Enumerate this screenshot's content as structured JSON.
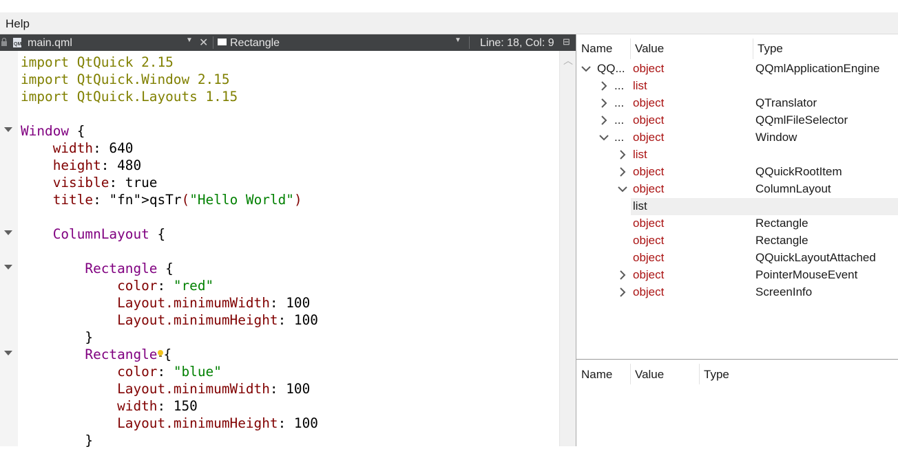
{
  "menubar": {
    "help": "Help"
  },
  "toolbar": {
    "file_name": "main.qml",
    "symbol": "Rectangle",
    "cursor_position": "Line: 18, Col: 9"
  },
  "editor": {
    "lines": {
      "l1": "import QtQuick 2.15",
      "l2": "import QtQuick.Window 2.15",
      "l3": "import QtQuick.Layouts 1.15",
      "l5": "Window {",
      "l6": "width: 640",
      "l7": "height: 480",
      "l8": "visible: true",
      "l9": "title: qsTr(\"Hello World\")",
      "l11": "ColumnLayout {",
      "l13": "Rectangle {",
      "l14": "color: \"red\"",
      "l15": "Layout.minimumWidth: 100",
      "l16": "Layout.minimumHeight: 100",
      "l17": "}",
      "l18": "Rectangle{",
      "l19": "color: \"blue\"",
      "l20": "Layout.minimumWidth: 100",
      "l21": "width: 150",
      "l22": "Layout.minimumHeight: 100",
      "l23": "}"
    }
  },
  "object_tree": {
    "columns": {
      "name": "Name",
      "value": "Value",
      "type": "Type"
    },
    "rows": [
      {
        "name": "QQ...",
        "value": "object",
        "type": "QQmlApplicationEngine",
        "expander": "expanded",
        "depth": 0
      },
      {
        "name": "...",
        "value": "list",
        "type": "",
        "expander": "collapsed",
        "depth": 1
      },
      {
        "name": "...",
        "value": "object",
        "type": "QTranslator",
        "expander": "collapsed",
        "depth": 1
      },
      {
        "name": "...",
        "value": "object",
        "type": "QQmlFileSelector",
        "expander": "collapsed",
        "depth": 1
      },
      {
        "name": "...",
        "value": "object",
        "type": "Window",
        "expander": "expanded",
        "depth": 1
      },
      {
        "name": "",
        "value": "list",
        "type": "",
        "expander": "collapsed",
        "depth": 2
      },
      {
        "name": "",
        "value": "object",
        "type": "QQuickRootItem",
        "expander": "collapsed",
        "depth": 2
      },
      {
        "name": "",
        "value": "object",
        "type": "ColumnLayout",
        "expander": "expanded",
        "depth": 2
      },
      {
        "name": "",
        "value": "list",
        "type": "",
        "expander": "none",
        "depth": 3,
        "selected": true
      },
      {
        "name": "",
        "value": "object",
        "type": "Rectangle",
        "expander": "none",
        "depth": 3
      },
      {
        "name": "",
        "value": "object",
        "type": "Rectangle",
        "expander": "none",
        "depth": 3
      },
      {
        "name": "",
        "value": "object",
        "type": "QQuickLayoutAttached",
        "expander": "none",
        "depth": 3
      },
      {
        "name": "",
        "value": "object",
        "type": "PointerMouseEvent",
        "expander": "collapsed",
        "depth": 2
      },
      {
        "name": "",
        "value": "object",
        "type": "ScreenInfo",
        "expander": "collapsed",
        "depth": 2
      }
    ]
  },
  "properties": {
    "columns": {
      "name": "Name",
      "value": "Value",
      "type": "Type"
    }
  },
  "colors": {
    "keyword": "#808000",
    "type": "#800080",
    "property": "#800000",
    "string": "#008000",
    "function": "#2a7bc0",
    "tree_value": "#aa1212",
    "toolbar_bg": "#404244"
  }
}
